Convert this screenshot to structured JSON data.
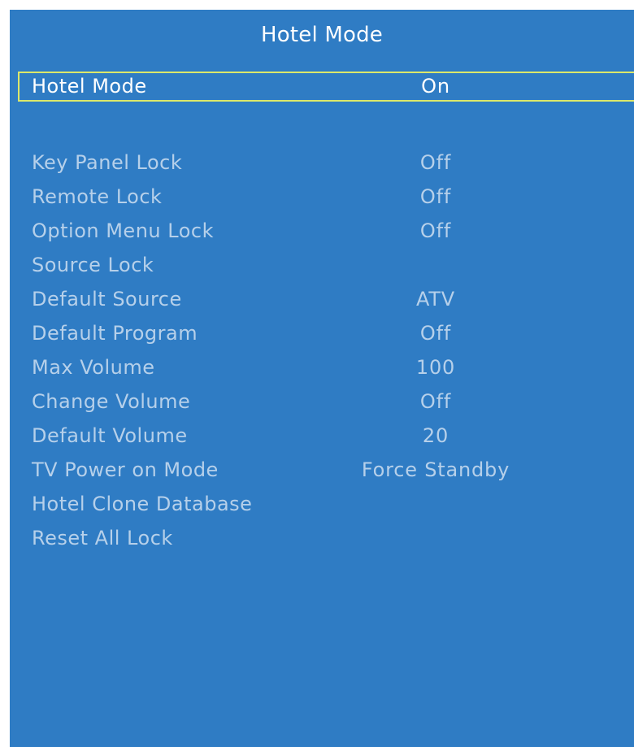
{
  "menu": {
    "title": "Hotel Mode",
    "selected_item": {
      "label": "Hotel Mode",
      "value": "On"
    },
    "items": [
      {
        "label": "Key Panel Lock",
        "value": "Off"
      },
      {
        "label": "Remote Lock",
        "value": "Off"
      },
      {
        "label": "Option Menu Lock",
        "value": "Off"
      },
      {
        "label": "Source Lock",
        "value": ""
      },
      {
        "label": "Default Source",
        "value": "ATV"
      },
      {
        "label": "Default Program",
        "value": "Off"
      },
      {
        "label": "Max Volume",
        "value": "100"
      },
      {
        "label": "Change Volume",
        "value": "Off"
      },
      {
        "label": "Default Volume",
        "value": "20"
      },
      {
        "label": "TV Power on Mode",
        "value": "Force Standby"
      },
      {
        "label": "Hotel Clone Database",
        "value": ""
      },
      {
        "label": "Reset All Lock",
        "value": ""
      }
    ]
  },
  "colors": {
    "background": "#2f7cc4",
    "selection_border": "#dce86a",
    "text_active": "#ffffff",
    "text_dim": "#b6d0ea"
  }
}
